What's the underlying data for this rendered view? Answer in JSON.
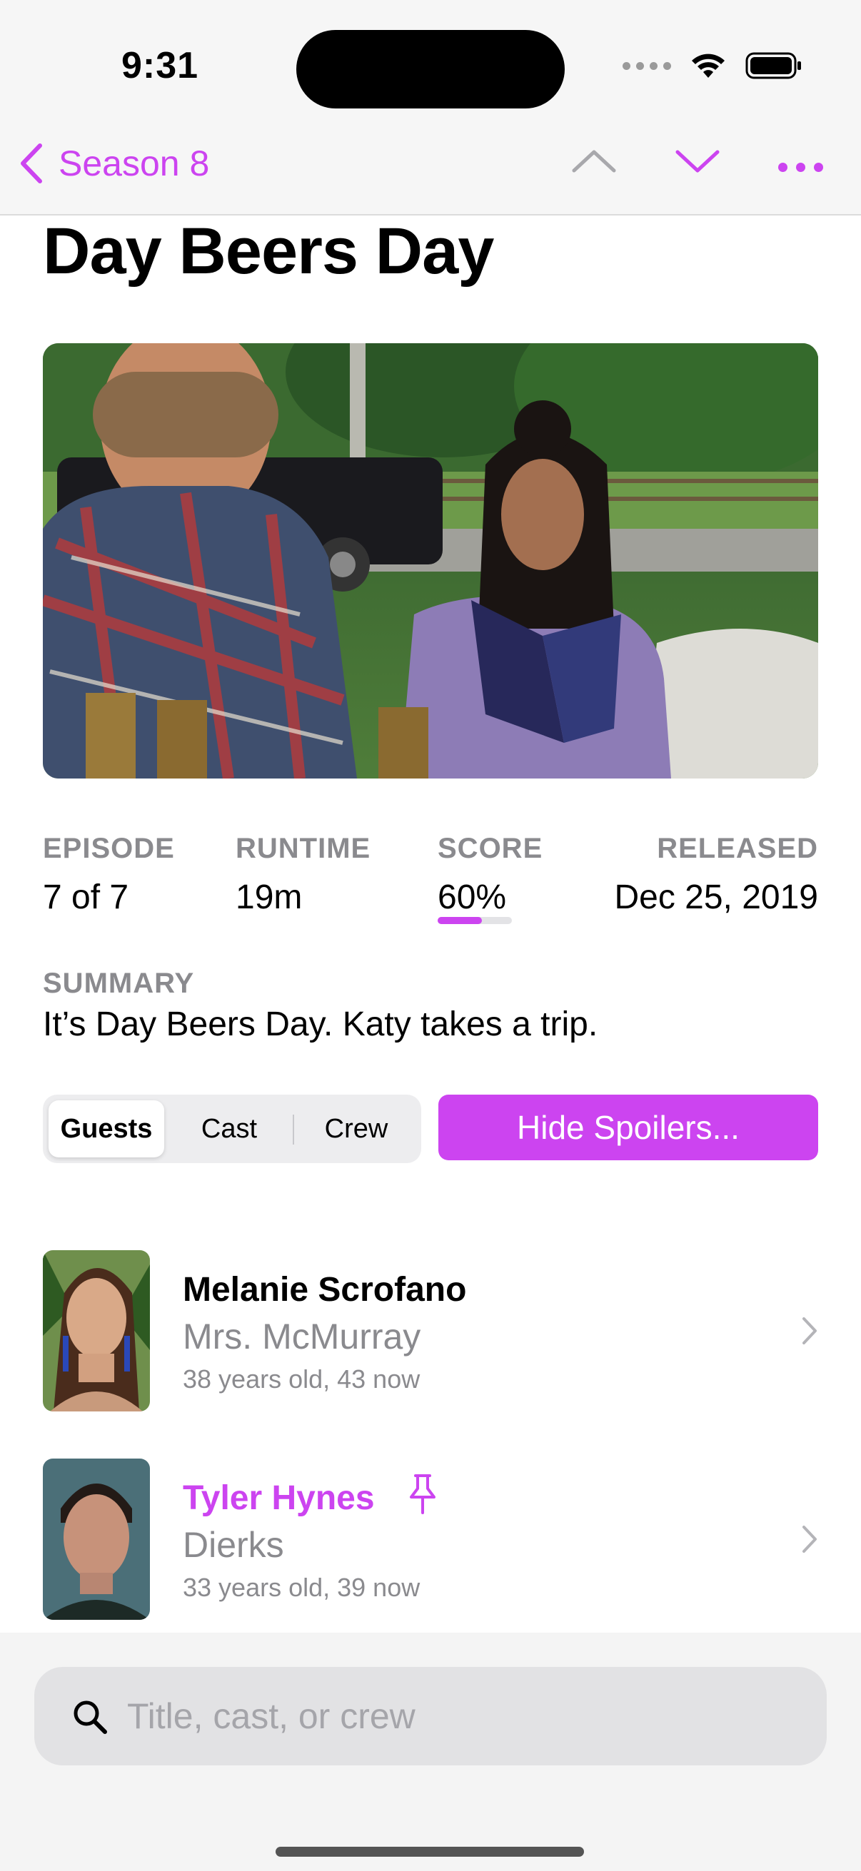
{
  "status": {
    "time": "9:31"
  },
  "nav": {
    "back_label": "Season 8"
  },
  "episode": {
    "title": "Day Beers Day",
    "meta": {
      "episode_label": "EPISODE",
      "episode_value": "7 of 7",
      "runtime_label": "RUNTIME",
      "runtime_value": "19m",
      "score_label": "SCORE",
      "score_value": "60%",
      "score_fraction": 0.6,
      "released_label": "RELEASED",
      "released_value": "Dec 25, 2019"
    },
    "summary_label": "SUMMARY",
    "summary": "It’s Day Beers Day. Katy takes a trip."
  },
  "tabs": [
    {
      "label": "Guests",
      "active": true
    },
    {
      "label": "Cast",
      "active": false
    },
    {
      "label": "Crew",
      "active": false
    }
  ],
  "hide_spoilers_label": "Hide Spoilers...",
  "people": [
    {
      "name": "Melanie Scrofano",
      "role": "Mrs. McMurray",
      "age": "38 years old, 43 now",
      "pinned": false
    },
    {
      "name": "Tyler Hynes",
      "role": "Dierks",
      "age": "33 years old, 39 now",
      "pinned": true
    }
  ],
  "search": {
    "placeholder": "Title, cast, or crew"
  },
  "colors": {
    "accent": "#cc44f0",
    "secondary_text": "#8a8a8e"
  },
  "icons": [
    "chevron-left-icon",
    "chevron-up-icon",
    "chevron-down-icon",
    "more-icon",
    "pin-icon",
    "chevron-right-icon",
    "search-icon",
    "wifi-icon",
    "battery-icon"
  ]
}
